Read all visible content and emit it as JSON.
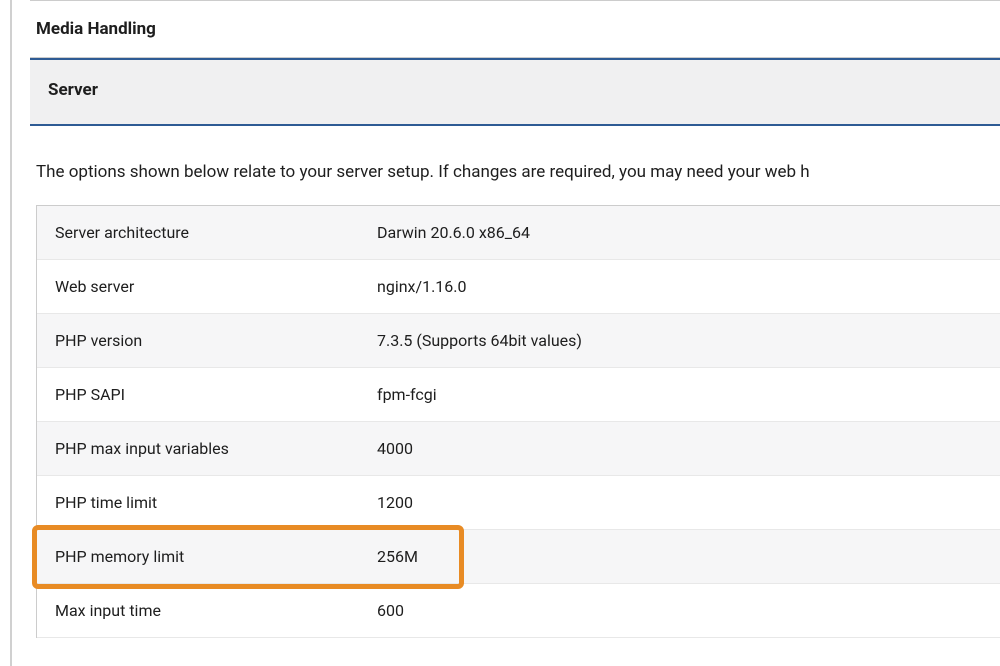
{
  "panels": {
    "media_handling": {
      "title": "Media Handling"
    },
    "server": {
      "title": "Server",
      "description": "The options shown below relate to your server setup. If changes are required, you may need your web h"
    }
  },
  "rows": [
    {
      "label": "Server architecture",
      "value": "Darwin 20.6.0 x86_64"
    },
    {
      "label": "Web server",
      "value": "nginx/1.16.0"
    },
    {
      "label": "PHP version",
      "value": "7.3.5 (Supports 64bit values)"
    },
    {
      "label": "PHP SAPI",
      "value": "fpm-fcgi"
    },
    {
      "label": "PHP max input variables",
      "value": "4000"
    },
    {
      "label": "PHP time limit",
      "value": "1200"
    },
    {
      "label": "PHP memory limit",
      "value": "256M"
    },
    {
      "label": "Max input time",
      "value": "600"
    }
  ],
  "highlight_index": 6
}
